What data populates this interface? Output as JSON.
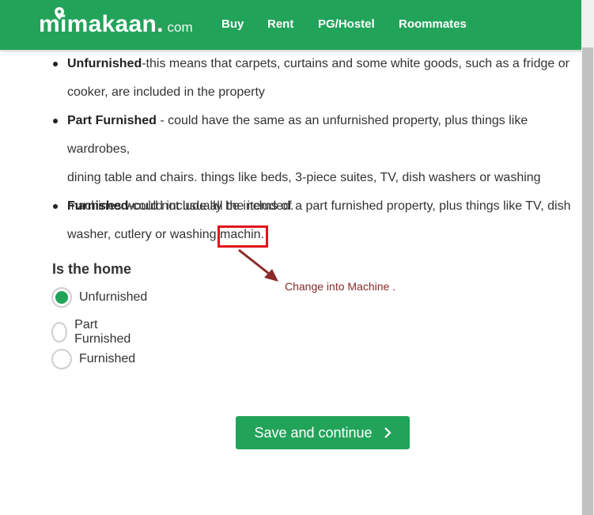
{
  "header": {
    "logo_main": "mimakaan",
    "logo_dot": ".",
    "logo_com": "com",
    "nav": [
      "Buy",
      "Rent",
      "PG/Hostel",
      "Roommates"
    ]
  },
  "bullets": [
    {
      "term": "Unfurnished",
      "line1": "-this means that carpets, curtains and some white goods, such as a fridge or",
      "line2": "cooker, are included in the property"
    },
    {
      "term": "Part Furnished",
      "line1": " - could have the same as an unfurnished property, plus things like wardrobes,",
      "line2": "dining table and chairs. things like beds, 3-piece suites, TV, dish washers or washing",
      "line3": "machines would not usually be included."
    },
    {
      "term": "Furnished",
      "line1": "-could include all the items of a part furnished property, plus things like TV, dish",
      "line2": "washer, cutlery or washing ",
      "highlight": "machin."
    }
  ],
  "annotation": "Change into Machine .",
  "question": "Is the home",
  "options": [
    {
      "label": "Unfurnished",
      "checked": true
    },
    {
      "label": "Part Furnished",
      "checked": false
    },
    {
      "label": "Furnished",
      "checked": false
    }
  ],
  "save_button": "Save and continue",
  "colors": {
    "brand": "#22a35a",
    "annotation_box": "#e0151b",
    "annotation_text": "#8a2a2a"
  }
}
